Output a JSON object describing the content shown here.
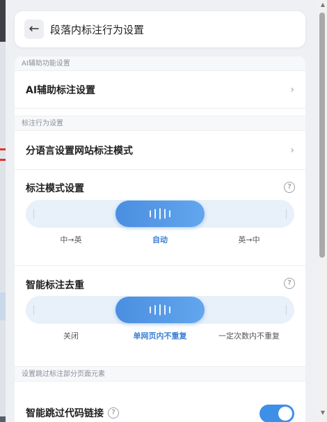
{
  "header": {
    "back_icon": "←",
    "title": "段落内标注行为设置"
  },
  "sections": {
    "ai": {
      "label": "AI辅助功能设置",
      "row_label": "AI辅助标注设置"
    },
    "behavior": {
      "label": "标注行为设置",
      "row_label": "分语言设置网站标注模式"
    },
    "skip": {
      "label": "设置跳过标注部分页面元素"
    }
  },
  "chevron_icon": "›",
  "help_icon": "?",
  "mode_setting": {
    "title": "标注模式设置",
    "options": [
      "中→英",
      "自动",
      "英→中"
    ],
    "selected_index": 1
  },
  "dedupe_setting": {
    "title": "智能标注去重",
    "options": [
      "关闭",
      "单网页内不重复",
      "一定次数内不重复"
    ],
    "selected_index": 1
  },
  "skip_code_links": {
    "label": "智能跳过代码链接",
    "enabled": true
  },
  "colors": {
    "accent": "#3c7fd4",
    "switch_on": "#3d8fe8",
    "track": "#e8f0fa"
  }
}
